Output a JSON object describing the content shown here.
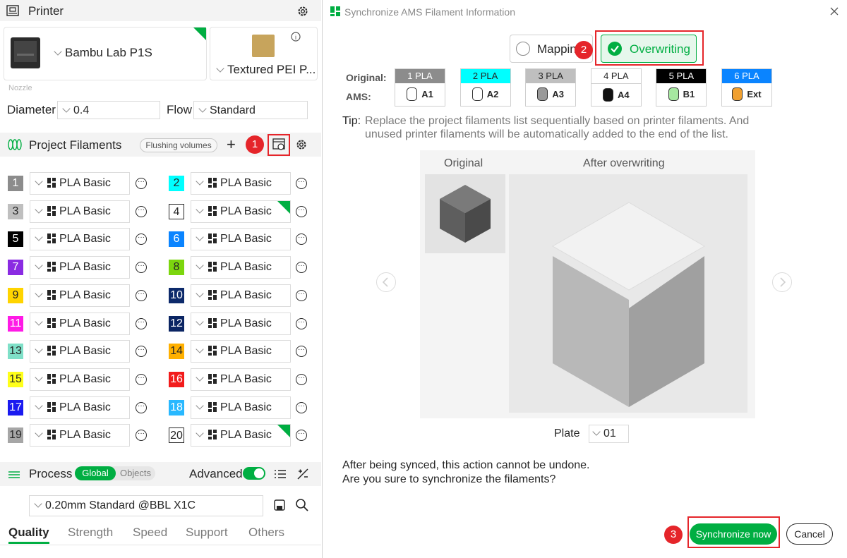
{
  "printer": {
    "section_title": "Printer",
    "printer_name": "Bambu Lab P1S",
    "plate_name": "Textured PEI P...",
    "nozzle_label": "Nozzle",
    "diameter_label": "Diameter",
    "diameter_value": "0.4",
    "flow_label": "Flow",
    "flow_value": "Standard"
  },
  "filaments": {
    "section_title": "Project Filaments",
    "flushing_label": "Flushing volumes",
    "add_label": "+",
    "items": [
      {
        "num": "1",
        "name": "PLA Basic",
        "color": "#8c8c8c",
        "text": "#ffffff"
      },
      {
        "num": "2",
        "name": "PLA Basic",
        "color": "#00ffff",
        "text": "#262626"
      },
      {
        "num": "3",
        "name": "PLA Basic",
        "color": "#bfbfbf",
        "text": "#262626"
      },
      {
        "num": "4",
        "name": "PLA Basic",
        "color": "#ffffff",
        "text": "#262626"
      },
      {
        "num": "5",
        "name": "PLA Basic",
        "color": "#000000",
        "text": "#ffffff"
      },
      {
        "num": "6",
        "name": "PLA Basic",
        "color": "#0a84ff",
        "text": "#ffffff"
      },
      {
        "num": "7",
        "name": "PLA Basic",
        "color": "#8a2be2",
        "text": "#ffffff"
      },
      {
        "num": "8",
        "name": "PLA Basic",
        "color": "#7cd60e",
        "text": "#262626"
      },
      {
        "num": "9",
        "name": "PLA Basic",
        "color": "#ffd400",
        "text": "#262626"
      },
      {
        "num": "10",
        "name": "PLA Basic",
        "color": "#0d2a6b",
        "text": "#ffffff"
      },
      {
        "num": "11",
        "name": "PLA Basic",
        "color": "#ff1ae6",
        "text": "#ffffff"
      },
      {
        "num": "12",
        "name": "PLA Basic",
        "color": "#0b2563",
        "text": "#ffffff"
      },
      {
        "num": "13",
        "name": "PLA Basic",
        "color": "#7fe0c8",
        "text": "#262626"
      },
      {
        "num": "14",
        "name": "PLA Basic",
        "color": "#ffb000",
        "text": "#262626"
      },
      {
        "num": "15",
        "name": "PLA Basic",
        "color": "#ffff1a",
        "text": "#262626"
      },
      {
        "num": "16",
        "name": "PLA Basic",
        "color": "#f21b1b",
        "text": "#ffffff"
      },
      {
        "num": "17",
        "name": "PLA Basic",
        "color": "#1a1af0",
        "text": "#ffffff"
      },
      {
        "num": "18",
        "name": "PLA Basic",
        "color": "#28b8ff",
        "text": "#ffffff"
      },
      {
        "num": "19",
        "name": "PLA Basic",
        "color": "#a6a6a6",
        "text": "#262626"
      },
      {
        "num": "20",
        "name": "PLA Basic",
        "color": "#ffffff",
        "text": "#262626"
      }
    ]
  },
  "process": {
    "section_title": "Process",
    "global_label": "Global",
    "objects_label": "Objects",
    "advanced_label": "Advanced",
    "profile_value": "0.20mm Standard @BBL X1C",
    "tabs": [
      "Quality",
      "Strength",
      "Speed",
      "Support",
      "Others"
    ]
  },
  "dialog": {
    "title": "Synchronize AMS Filament Information",
    "mapping_label": "Mappin",
    "overwriting_label": "Overwriting",
    "original_label": "Original:",
    "ams_label": "AMS:",
    "chips": [
      {
        "top": "1 PLA",
        "bottom": "A1",
        "top_bg": "#8c8c8c",
        "top_fg": "#ffffff",
        "spool": "#ffffff"
      },
      {
        "top": "2 PLA",
        "bottom": "A2",
        "top_bg": "#00ffff",
        "top_fg": "#262626",
        "spool": "#ffffff"
      },
      {
        "top": "3 PLA",
        "bottom": "A3",
        "top_bg": "#bfbfbf",
        "top_fg": "#262626",
        "spool": "#9a9a9a"
      },
      {
        "top": "4 PLA",
        "bottom": "A4",
        "top_bg": "#ffffff",
        "top_fg": "#262626",
        "spool": "#111111"
      },
      {
        "top": "5 PLA",
        "bottom": "B1",
        "top_bg": "#000000",
        "top_fg": "#ffffff",
        "spool": "#a6e8a0"
      },
      {
        "top": "6 PLA",
        "bottom": "Ext",
        "top_bg": "#0a84ff",
        "top_fg": "#ffffff",
        "spool": "#f0a030"
      }
    ],
    "tip_label": "Tip:",
    "tip_line1": "Replace the project filaments list sequentially based on printer filaments. And",
    "tip_line2": "unused printer filaments will be automatically added to the end of the list.",
    "original_header": "Original",
    "after_header": "After overwriting",
    "plate_label": "Plate",
    "plate_value": "01",
    "warn_line1": "After being synced, this action cannot be undone.",
    "warn_line2": "Are you sure to synchronize the filaments?",
    "sync_label": "Synchronize now",
    "cancel_label": "Cancel"
  },
  "annotations": [
    "1",
    "2",
    "3"
  ],
  "colors": {
    "accent": "#00ae42",
    "annotation": "#e5252a"
  }
}
